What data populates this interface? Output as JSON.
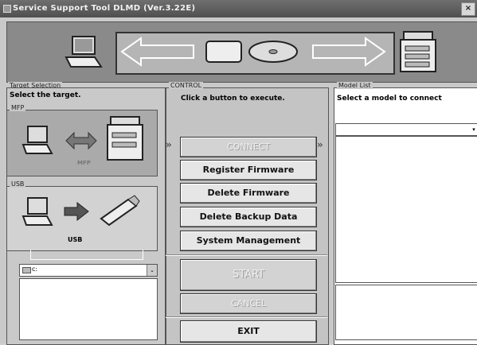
{
  "window": {
    "title": "Service Support Tool DLMD (Ver.3.22E)",
    "close_symbol": "×"
  },
  "target": {
    "group_label": "Target Selection",
    "hint": "Select the target.",
    "mfp_label": "MFP",
    "mfp_caption": "MFP",
    "usb_label": "USB",
    "usb_caption": "USB",
    "drive_value": "c:",
    "drive_arrow": "⌄"
  },
  "control": {
    "group_label": "CONTROL",
    "hint": "Click a button to execute.",
    "connect": "CONNECT",
    "register": "Register Firmware",
    "delete_fw": "Delete Firmware",
    "delete_backup": "Delete Backup Data",
    "system_mgmt": "System Management",
    "start": "START",
    "cancel": "CANCEL",
    "exit": "EXIT",
    "chev_left": "»",
    "chev_right": "»"
  },
  "models": {
    "group_label": "Model List",
    "hint": "Select a model to connect",
    "combo_arrow": "▾"
  }
}
